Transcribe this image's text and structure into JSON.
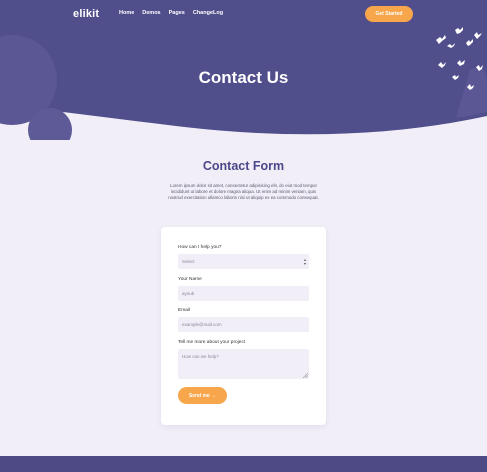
{
  "nav": {
    "logo": "elikit",
    "links": [
      "Home",
      "Demos",
      "Pages",
      "ChangeLog"
    ],
    "cta": "Get Started"
  },
  "hero": {
    "title": "Contact Us"
  },
  "section": {
    "heading": "Contact Form",
    "description": "Lorem ipsum dolor sit amet, consectetur adipisicing elit, do eiut mod tempor incididunt ut labore et dolore magna aliqua. Ut enim ad minim veniam, quis nostrud exercitation ullamco laboris nisi ut aliquip ex ea commodo consequat."
  },
  "form": {
    "help_label": "How can I help you?",
    "help_value": "Select",
    "name_label": "Your Name",
    "name_value": "ayoub",
    "email_label": "Email",
    "email_placeholder": "example@mail.com",
    "project_label": "Tell me more about your project",
    "project_placeholder": "How can we help?",
    "send_label": "Send me →"
  },
  "colors": {
    "hero": "#514e8c",
    "accent": "#f7a64b",
    "background": "#f1eef7"
  }
}
